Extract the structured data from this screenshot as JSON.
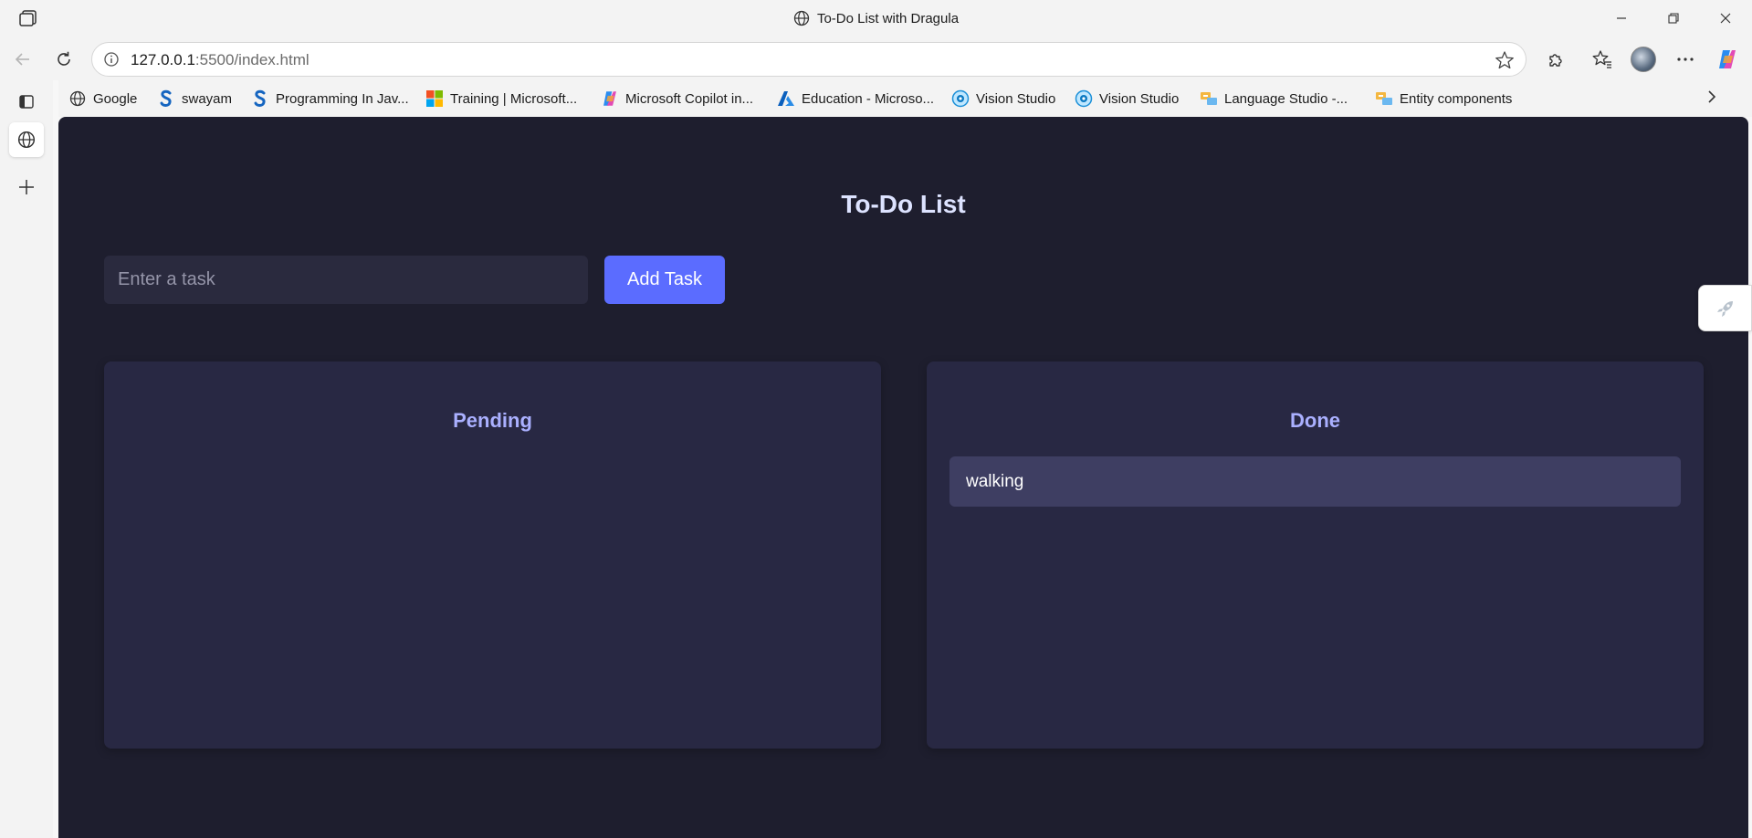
{
  "window": {
    "title": "To-Do List with Dragula"
  },
  "address_bar": {
    "url_host": "127.0.0.1",
    "url_rest": ":5500/index.html"
  },
  "bookmarks": [
    {
      "label": "Google",
      "icon": "globe-icon"
    },
    {
      "label": "swayam",
      "icon": "swayam-s-icon"
    },
    {
      "label": "Programming In Jav...",
      "icon": "swayam-s-icon"
    },
    {
      "label": "Training | Microsoft...",
      "icon": "microsoft-logo-icon"
    },
    {
      "label": "Microsoft Copilot in...",
      "icon": "copilot-icon"
    },
    {
      "label": "Education - Microso...",
      "icon": "azure-icon"
    },
    {
      "label": "Vision Studio",
      "icon": "vision-studio-icon"
    },
    {
      "label": "Vision Studio",
      "icon": "vision-studio-icon"
    },
    {
      "label": "Language Studio -...",
      "icon": "language-studio-icon"
    },
    {
      "label": "Entity components",
      "icon": "language-studio-icon"
    }
  ],
  "app": {
    "heading": "To-Do List",
    "input_placeholder": "Enter a task",
    "input_value": "",
    "add_button": "Add Task",
    "columns": [
      {
        "title": "Pending",
        "tasks": []
      },
      {
        "title": "Done",
        "tasks": [
          "walking"
        ]
      }
    ]
  },
  "colors": {
    "page_bg": "#1e1e2e",
    "column_bg": "#282843",
    "accent": "#5b6cff",
    "column_title": "#aab0ff",
    "task_bg": "#3e3e62"
  }
}
